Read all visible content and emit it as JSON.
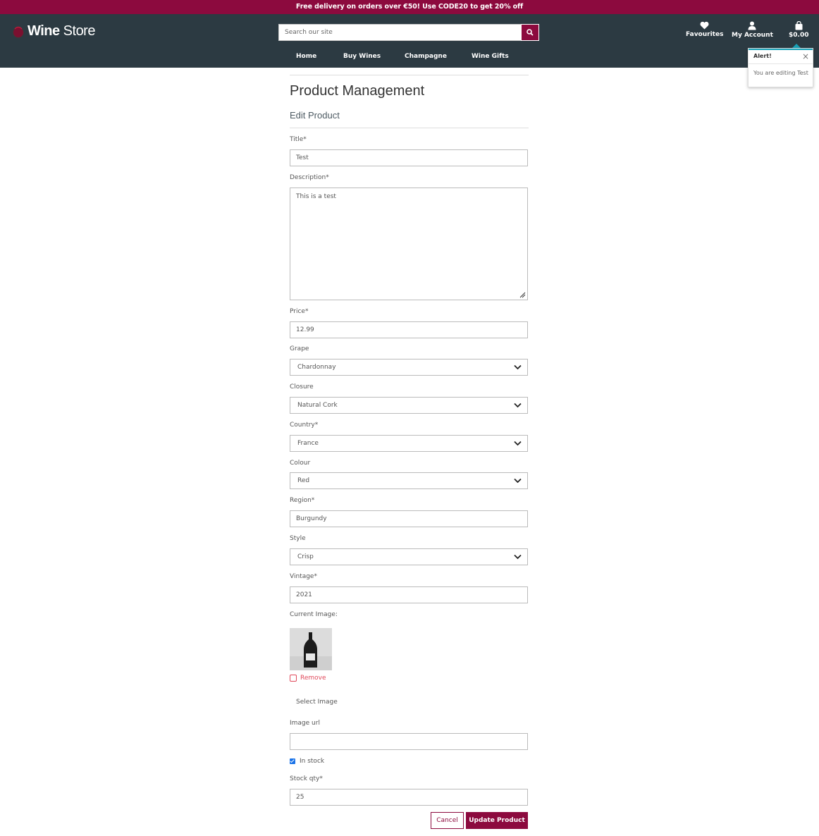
{
  "banner": {
    "text": "Free delivery on orders over €50!  Use CODE20 to get 20% off"
  },
  "brand": {
    "name_bold": "Wine",
    "name_rest": " Store"
  },
  "search": {
    "placeholder": "Search our site"
  },
  "header_links": {
    "favourites": "Favourites",
    "account": "My Account",
    "cart_total": "$0.00"
  },
  "nav": {
    "items": [
      "Home",
      "Buy Wines",
      "Champagne",
      "Wine Gifts"
    ]
  },
  "alert": {
    "title": "Alert!",
    "close": "×",
    "message": "You are editing Test"
  },
  "page": {
    "title": "Product Management",
    "subtitle": "Edit Product"
  },
  "form": {
    "title_label": "Title*",
    "title_value": "Test",
    "description_label": "Description*",
    "description_value": "This is a test",
    "price_label": "Price*",
    "price_value": "12.99",
    "grape_label": "Grape",
    "grape_value": "Chardonnay",
    "closure_label": "Closure",
    "closure_value": "Natural Cork",
    "country_label": "Country*",
    "country_value": "France",
    "colour_label": "Colour",
    "colour_value": "Red",
    "region_label": "Region*",
    "region_value": "Burgundy",
    "style_label": "Style",
    "style_value": "Crisp",
    "vintage_label": "Vintage*",
    "vintage_value": "2021",
    "current_image_label": "Current Image:",
    "remove_label": "Remove",
    "select_image_label": "Select Image",
    "image_url_label": "Image url",
    "image_url_value": "",
    "in_stock_label": "In stock",
    "stock_qty_label": "Stock qty*",
    "stock_qty_value": "25"
  },
  "actions": {
    "cancel": "Cancel",
    "update": "Update Product"
  },
  "colors": {
    "brand": "#8c0a3e",
    "header": "#2c3a42",
    "alert_accent": "#17a2b8"
  }
}
